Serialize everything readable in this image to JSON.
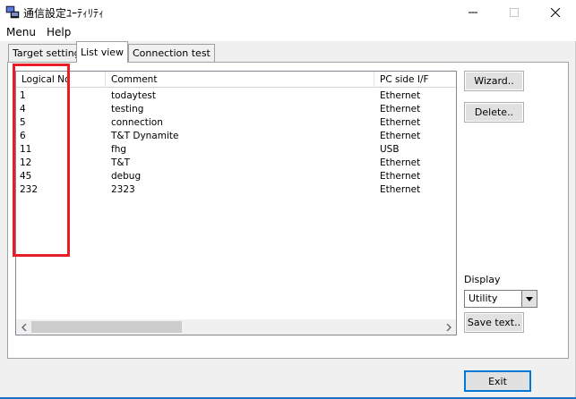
{
  "window": {
    "title": "通信設定ﾕｰﾃｨﾘﾃｨ"
  },
  "menu": [
    "Menu",
    "Help"
  ],
  "tabs": [
    {
      "label": "Target setting",
      "active": false
    },
    {
      "label": "List view",
      "active": true
    },
    {
      "label": "Connection test",
      "active": false
    }
  ],
  "list": {
    "columns": [
      "Logical No",
      "Comment",
      "PC side I/F"
    ],
    "rows": [
      {
        "no": "1",
        "comment": "todaytest",
        "iface": "Ethernet"
      },
      {
        "no": "4",
        "comment": "testing",
        "iface": "Ethernet"
      },
      {
        "no": "5",
        "comment": "connection",
        "iface": "Ethernet"
      },
      {
        "no": "6",
        "comment": "T&T Dynamite",
        "iface": "Ethernet"
      },
      {
        "no": "11",
        "comment": "fhg",
        "iface": "USB"
      },
      {
        "no": "12",
        "comment": "T&T",
        "iface": "Ethernet"
      },
      {
        "no": "45",
        "comment": "debug",
        "iface": "Ethernet"
      },
      {
        "no": "232",
        "comment": "2323",
        "iface": "Ethernet"
      }
    ]
  },
  "buttons": {
    "wizard": "Wizard..",
    "delete": "Delete..",
    "save_text": "Save text..",
    "exit": "Exit"
  },
  "display": {
    "label": "Display",
    "selected": "Utility"
  },
  "colors": {
    "highlight": "#e81d25",
    "default_button_border": "#0078d7"
  },
  "icons": [
    "app-icon",
    "minimize-icon",
    "maximize-icon",
    "close-icon",
    "chevron-down-icon",
    "chevron-left-icon",
    "chevron-right-icon"
  ]
}
